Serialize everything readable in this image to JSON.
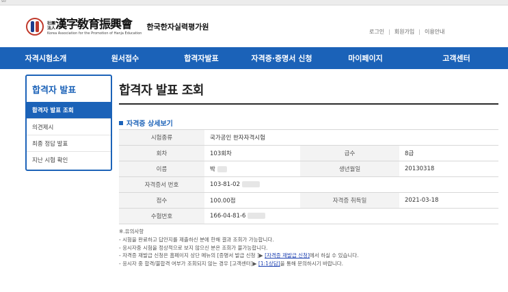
{
  "browser": {
    "strip_text": "so"
  },
  "header": {
    "logo_small": "社團法人",
    "logo_hanja": "漢字敎育振興會",
    "logo_english": "Korea Association for the Promotion of Hanja Education",
    "logo_korean": "한국한자실력평가원",
    "util": [
      "로그인",
      "회원가입",
      "이용안내"
    ]
  },
  "gnb": [
    "자격시험소개",
    "원서접수",
    "합격자발표",
    "자격증·증명서 신청",
    "마이페이지",
    "고객센터"
  ],
  "lnb": {
    "title": "합격자 발표",
    "items": [
      {
        "label": "합격자 발표 조회",
        "active": true
      },
      {
        "label": "의견제시",
        "active": false
      },
      {
        "label": "최종 정답 발표",
        "active": false
      },
      {
        "label": "지난 시험 확인",
        "active": false
      }
    ]
  },
  "page": {
    "title": "합격자 발표 조회",
    "section_title": "자격증 상세보기"
  },
  "detail": {
    "exam_type_label": "시험종류",
    "exam_type_value": "국가공인 한자자격시험",
    "round_label": "회차",
    "round_value": "103회차",
    "grade_label": "급수",
    "grade_value": "8급",
    "name_label": "이름",
    "name_value": "박",
    "birth_label": "생년월일",
    "birth_value": "20130318",
    "cert_no_label": "자격증서 번호",
    "cert_no_value": "103-81-02",
    "score_label": "점수",
    "score_value": "100.00점",
    "acq_date_label": "자격증 취득일",
    "acq_date_value": "2021-03-18",
    "exam_no_label": "수험번호",
    "exam_no_value": "166-04-81-6"
  },
  "notes": {
    "heading": "※.유의사항",
    "line1": "- 시험을 완료하고 답안지를 제출하신 분에 한해 결과 조회가 가능합니다.",
    "line2": "- 응시자중 시험을 정상적으로 보지 않으신 분은 조회가 불가능합니다.",
    "line3_pre": "- 자격증 재발급 신청은 홈페이지 상단 메뉴의 [증명서 발급 신청 ]▶ ",
    "line3_link": "[자격증 재발급 신청]",
    "line3_post": "에서 하실 수 있습니다.",
    "line4_pre": "- 응시자 중 합격/불합격 여부가 조회되지 않는 경우 [고객센터]▶ ",
    "line4_link": "[1:1상담]",
    "line4_post": "을 통해 문의하시기 바랍니다."
  },
  "colors": {
    "brand_blue": "#1b62b8",
    "header_bg": "#f3f3f3"
  }
}
